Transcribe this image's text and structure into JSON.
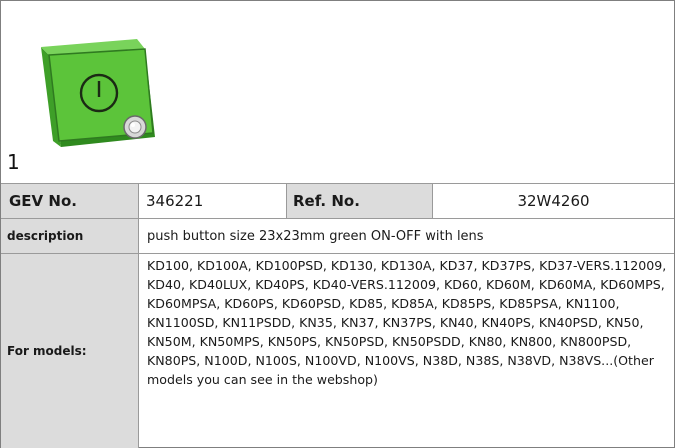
{
  "figure": {
    "index": "1",
    "product_icon": "green-square-push-button-with-power-symbol-and-lens"
  },
  "table": {
    "gev_label": "GEV No.",
    "gev_value": "346221",
    "ref_label": "Ref. No.",
    "ref_value": "32W4260",
    "description_label": "description",
    "description_value": "push button  size 23x23mm green ON-OFF with lens",
    "models_label": "For models:",
    "models_value": "KD100, KD100A, KD100PSD, KD130, KD130A, KD37, KD37PS, KD37-VERS.112009, KD40, KD40LUX, KD40PS, KD40-VERS.112009, KD60, KD60M, KD60MA, KD60MPS, KD60MPSA, KD60PS, KD60PSD, KD85, KD85A, KD85PS, KD85PSA, KN1100, KN1100SD, KN11PSDD, KN35, KN37, KN37PS, KN40, KN40PS, KN40PSD, KN50, KN50M, KN50MPS, KN50PS, KN50PSD, KN50PSDD, KN80, KN800, KN800PSD, KN80PS, N100D, N100S, N100VD, N100VS, N38D, N38S, N38VD, N38VS...(Other models you can see in the webshop)"
  },
  "colors": {
    "header_bg": "#dcdcdc",
    "button_green": "#5cc43a",
    "button_dark_green": "#2f8a1e"
  }
}
